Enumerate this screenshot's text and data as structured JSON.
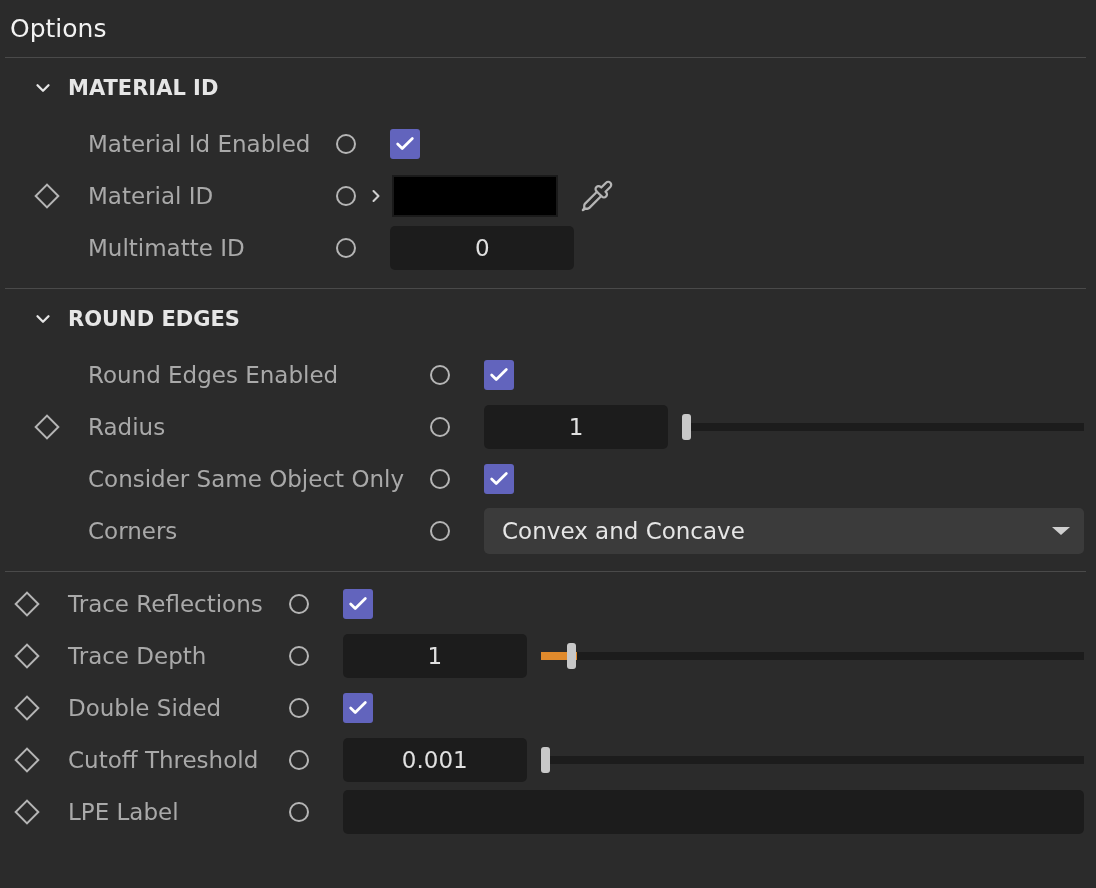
{
  "title": "Options",
  "sections": [
    {
      "kind": "group",
      "title": "MATERIAL ID",
      "expanded": true,
      "rows": [
        {
          "label": "Material Id Enabled",
          "keyframe": false,
          "kind": "checkbox",
          "checked": true
        },
        {
          "label": "Material ID",
          "keyframe": true,
          "kind": "color",
          "color": "#000000"
        },
        {
          "label": "Multimatte ID",
          "keyframe": false,
          "kind": "number",
          "value": "0"
        }
      ]
    },
    {
      "kind": "group",
      "title": "ROUND EDGES",
      "expanded": true,
      "rows": [
        {
          "label": "Round Edges Enabled",
          "keyframe": false,
          "kind": "checkbox",
          "checked": true
        },
        {
          "label": "Radius",
          "keyframe": true,
          "kind": "slider",
          "value": "1",
          "level": 0
        },
        {
          "label": "Consider Same Object Only",
          "keyframe": false,
          "kind": "checkbox",
          "checked": true
        },
        {
          "label": "Corners",
          "keyframe": false,
          "kind": "dropdown",
          "value": "Convex and Concave"
        }
      ]
    },
    {
      "kind": "plain",
      "rows": [
        {
          "label": "Trace Reflections",
          "keyframe": true,
          "kind": "checkbox",
          "checked": true
        },
        {
          "label": "Trace Depth",
          "keyframe": true,
          "kind": "slider",
          "value": "1",
          "level": 0.05
        },
        {
          "label": "Double Sided",
          "keyframe": true,
          "kind": "checkbox",
          "checked": true
        },
        {
          "label": "Cutoff Threshold",
          "keyframe": true,
          "kind": "slider",
          "value": "0.001",
          "level": 0
        },
        {
          "label": "LPE Label",
          "keyframe": true,
          "kind": "text"
        }
      ]
    }
  ]
}
